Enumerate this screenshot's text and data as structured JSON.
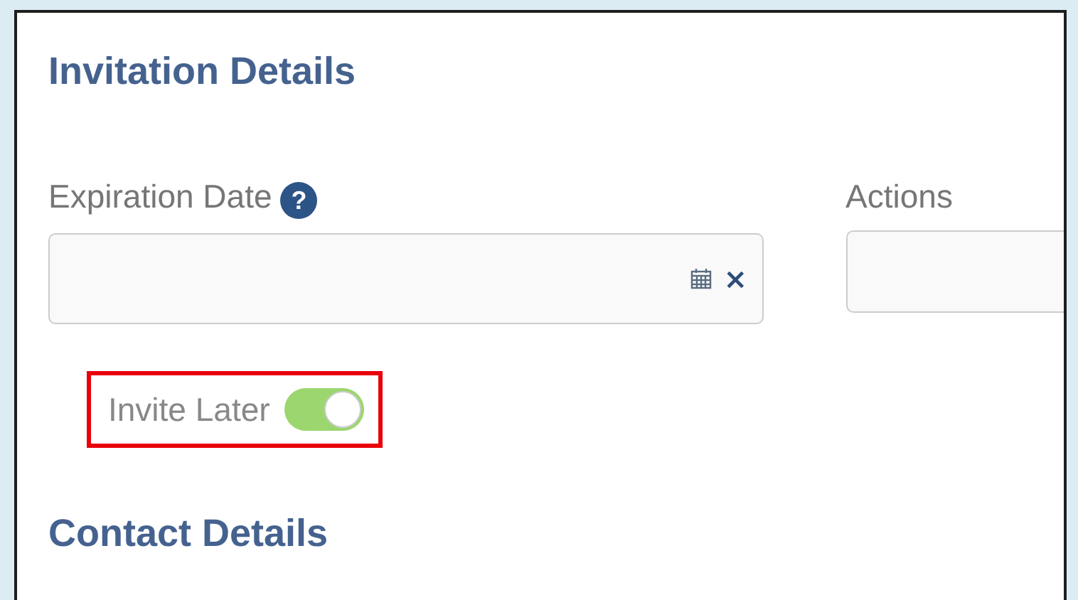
{
  "sections": [
    {
      "title": "Invitation Details"
    },
    {
      "title": "Contact Details"
    }
  ],
  "fields": [
    {
      "label": "Expiration Date",
      "help": "?",
      "clear": "×"
    },
    {
      "label": "Actions"
    }
  ],
  "invite_later": {
    "label": "Invite Later",
    "on": true,
    "highlighted": true
  }
}
